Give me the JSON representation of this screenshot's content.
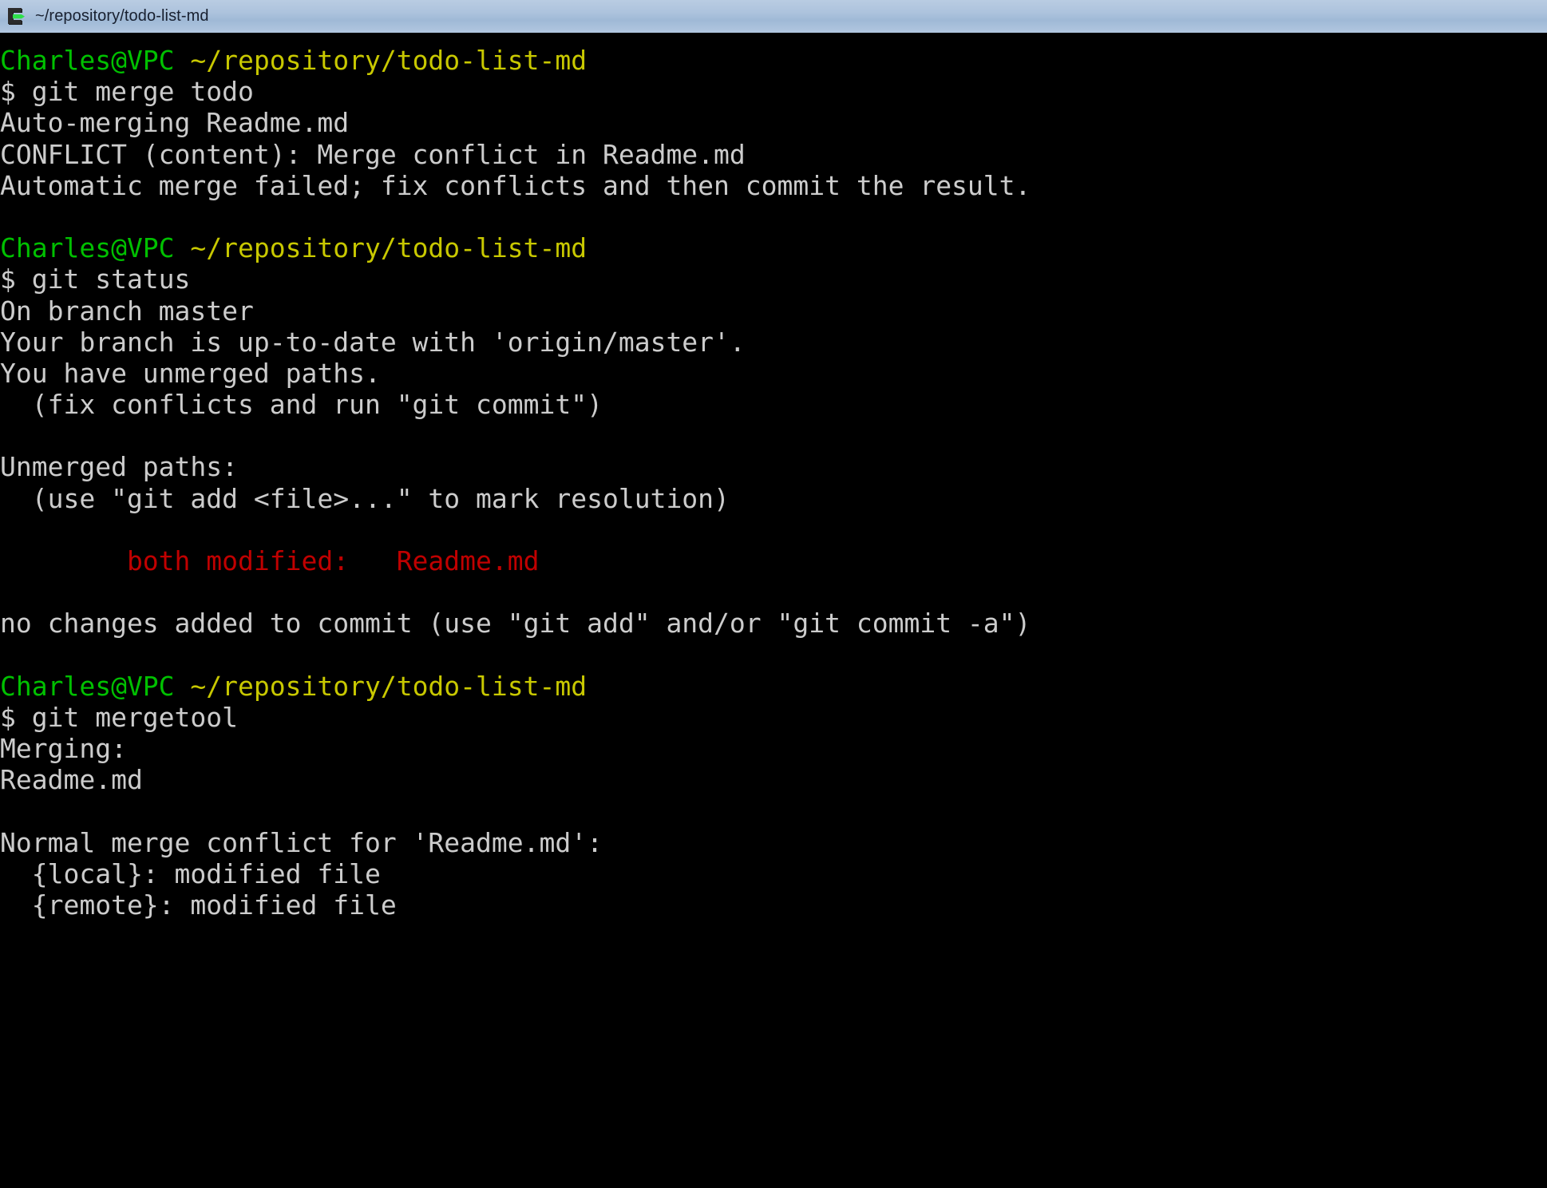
{
  "window": {
    "title": "~/repository/todo-list-md",
    "icon": "terminal-icon"
  },
  "colors": {
    "background": "#000000",
    "foreground": "#cccccc",
    "green": "#00c000",
    "yellow": "#c8c800",
    "red": "#c00000",
    "titlebar_top": "#b9cce2",
    "titlebar_bottom": "#b2c7e0",
    "titlebar_text": "#182030"
  },
  "terminal": {
    "user_host": "Charles@VPC",
    "cwd": "~/repository/todo-list-md",
    "prompt_symbol": "$",
    "lines": [
      {
        "id": "line-1",
        "kind": "prompt",
        "user": "Charles@VPC",
        "path": "~/repository/todo-list-md"
      },
      {
        "id": "line-2",
        "kind": "command",
        "text": "$ git merge todo"
      },
      {
        "id": "line-3",
        "kind": "output",
        "text": "Auto-merging Readme.md"
      },
      {
        "id": "line-4",
        "kind": "output",
        "text": "CONFLICT (content): Merge conflict in Readme.md"
      },
      {
        "id": "line-5",
        "kind": "output",
        "text": "Automatic merge failed; fix conflicts and then commit the result."
      },
      {
        "id": "line-6",
        "kind": "blank",
        "text": ""
      },
      {
        "id": "line-7",
        "kind": "prompt",
        "user": "Charles@VPC",
        "path": "~/repository/todo-list-md"
      },
      {
        "id": "line-8",
        "kind": "command",
        "text": "$ git status"
      },
      {
        "id": "line-9",
        "kind": "output",
        "text": "On branch master"
      },
      {
        "id": "line-10",
        "kind": "output",
        "text": "Your branch is up-to-date with 'origin/master'."
      },
      {
        "id": "line-11",
        "kind": "output",
        "text": "You have unmerged paths."
      },
      {
        "id": "line-12",
        "kind": "output",
        "text": "  (fix conflicts and run \"git commit\")"
      },
      {
        "id": "line-13",
        "kind": "blank",
        "text": ""
      },
      {
        "id": "line-14",
        "kind": "output",
        "text": "Unmerged paths:"
      },
      {
        "id": "line-15",
        "kind": "output",
        "text": "  (use \"git add <file>...\" to mark resolution)"
      },
      {
        "id": "line-16",
        "kind": "blank",
        "text": ""
      },
      {
        "id": "line-17",
        "kind": "conflict",
        "text": "        both modified:   Readme.md"
      },
      {
        "id": "line-18",
        "kind": "blank",
        "text": ""
      },
      {
        "id": "line-19",
        "kind": "output",
        "text": "no changes added to commit (use \"git add\" and/or \"git commit -a\")"
      },
      {
        "id": "line-20",
        "kind": "blank",
        "text": ""
      },
      {
        "id": "line-21",
        "kind": "prompt",
        "user": "Charles@VPC",
        "path": "~/repository/todo-list-md"
      },
      {
        "id": "line-22",
        "kind": "command",
        "text": "$ git mergetool"
      },
      {
        "id": "line-23",
        "kind": "output",
        "text": "Merging:"
      },
      {
        "id": "line-24",
        "kind": "output",
        "text": "Readme.md"
      },
      {
        "id": "line-25",
        "kind": "blank",
        "text": ""
      },
      {
        "id": "line-26",
        "kind": "output",
        "text": "Normal merge conflict for 'Readme.md':"
      },
      {
        "id": "line-27",
        "kind": "output",
        "text": "  {local}: modified file"
      },
      {
        "id": "line-28",
        "kind": "output",
        "text": "  {remote}: modified file"
      }
    ]
  }
}
